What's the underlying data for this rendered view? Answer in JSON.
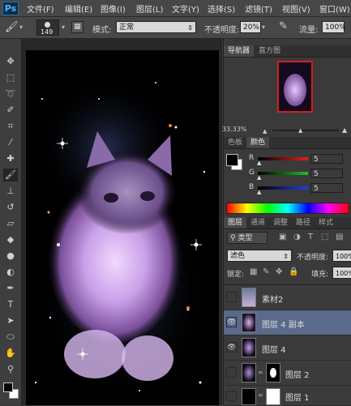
{
  "menu": {
    "logo": "Ps",
    "items": [
      "文件(F)",
      "编辑(E)",
      "图像(I)",
      "图层(L)",
      "文字(Y)",
      "选择(S)",
      "滤镜(T)",
      "视图(V)",
      "窗口(W)"
    ]
  },
  "options": {
    "brush_size": "149",
    "mode_label": "模式:",
    "mode_value": "正常",
    "opacity_label": "不透明度:",
    "opacity_value": "20%",
    "flow_label": "流量:",
    "flow_value": "100%"
  },
  "navigator": {
    "tabs": [
      "导航器",
      "直方图"
    ],
    "zoom": "33.33%"
  },
  "color_panel": {
    "tabs": [
      "色板",
      "颜色"
    ],
    "channels": [
      {
        "label": "R",
        "value": "5",
        "color": "#e02020"
      },
      {
        "label": "G",
        "value": "5",
        "color": "#20c020"
      },
      {
        "label": "B",
        "value": "5",
        "color": "#2040e0"
      }
    ]
  },
  "layers_panel": {
    "tabs": [
      "图层",
      "通道",
      "调整",
      "路径",
      "样式"
    ],
    "filter_label": "类型",
    "blend_mode": "滤色",
    "opacity_label": "不透明度:",
    "opacity_value": "100%",
    "lock_label": "锁定:",
    "fill_label": "填充:",
    "fill_value": "100%",
    "layers": [
      {
        "name": "素材2",
        "visible": false,
        "selected": false
      },
      {
        "name": "图层 4 副本",
        "visible": true,
        "selected": true
      },
      {
        "name": "图层 4",
        "visible": true,
        "selected": false
      },
      {
        "name": "图层 2",
        "visible": false,
        "selected": false,
        "mask": true
      },
      {
        "name": "图层 1",
        "visible": false,
        "selected": false,
        "mask": true
      }
    ]
  },
  "colors": {
    "foreground": "#000000",
    "background": "#ffffff",
    "accent": "#596a8a"
  }
}
